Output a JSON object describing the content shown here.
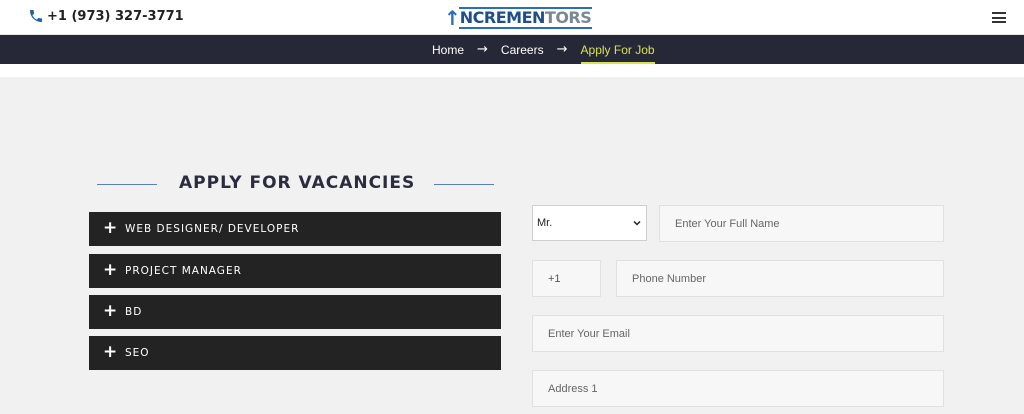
{
  "topbar": {
    "phone": "+1 (973) 327-3771",
    "logo": {
      "arrow": "↑",
      "part1": "NCRE",
      "part2": "MEN",
      "part3": "T",
      "part4": "ORS"
    }
  },
  "breadcrumb": [
    {
      "label": "Home"
    },
    {
      "label": "Careers"
    },
    {
      "label": "Apply For Job"
    }
  ],
  "breadcrumb_sep": "→",
  "section": {
    "title": "APPLY FOR VACANCIES"
  },
  "vacancies": [
    {
      "label": "WEB DESIGNER/ DEVELOPER"
    },
    {
      "label": "PROJECT MANAGER"
    },
    {
      "label": "BD"
    },
    {
      "label": "SEO"
    }
  ],
  "form": {
    "salutation": {
      "value": "Mr."
    },
    "full_name": {
      "placeholder": "Enter Your Full Name"
    },
    "country_code": {
      "value": "+1"
    },
    "phone": {
      "placeholder": "Phone Number"
    },
    "email": {
      "placeholder": "Enter Your Email"
    },
    "address1": {
      "placeholder": "Address 1"
    }
  },
  "icons": {
    "phone": "phone-icon",
    "menu": "hamburger-menu-icon",
    "plus": "plus-icon",
    "caret": "chevron-down-icon"
  },
  "colors": {
    "navbar": "#262838",
    "active_crumb": "#d6e34f",
    "accordion": "#232323",
    "heading_line": "#5b7fb4"
  }
}
